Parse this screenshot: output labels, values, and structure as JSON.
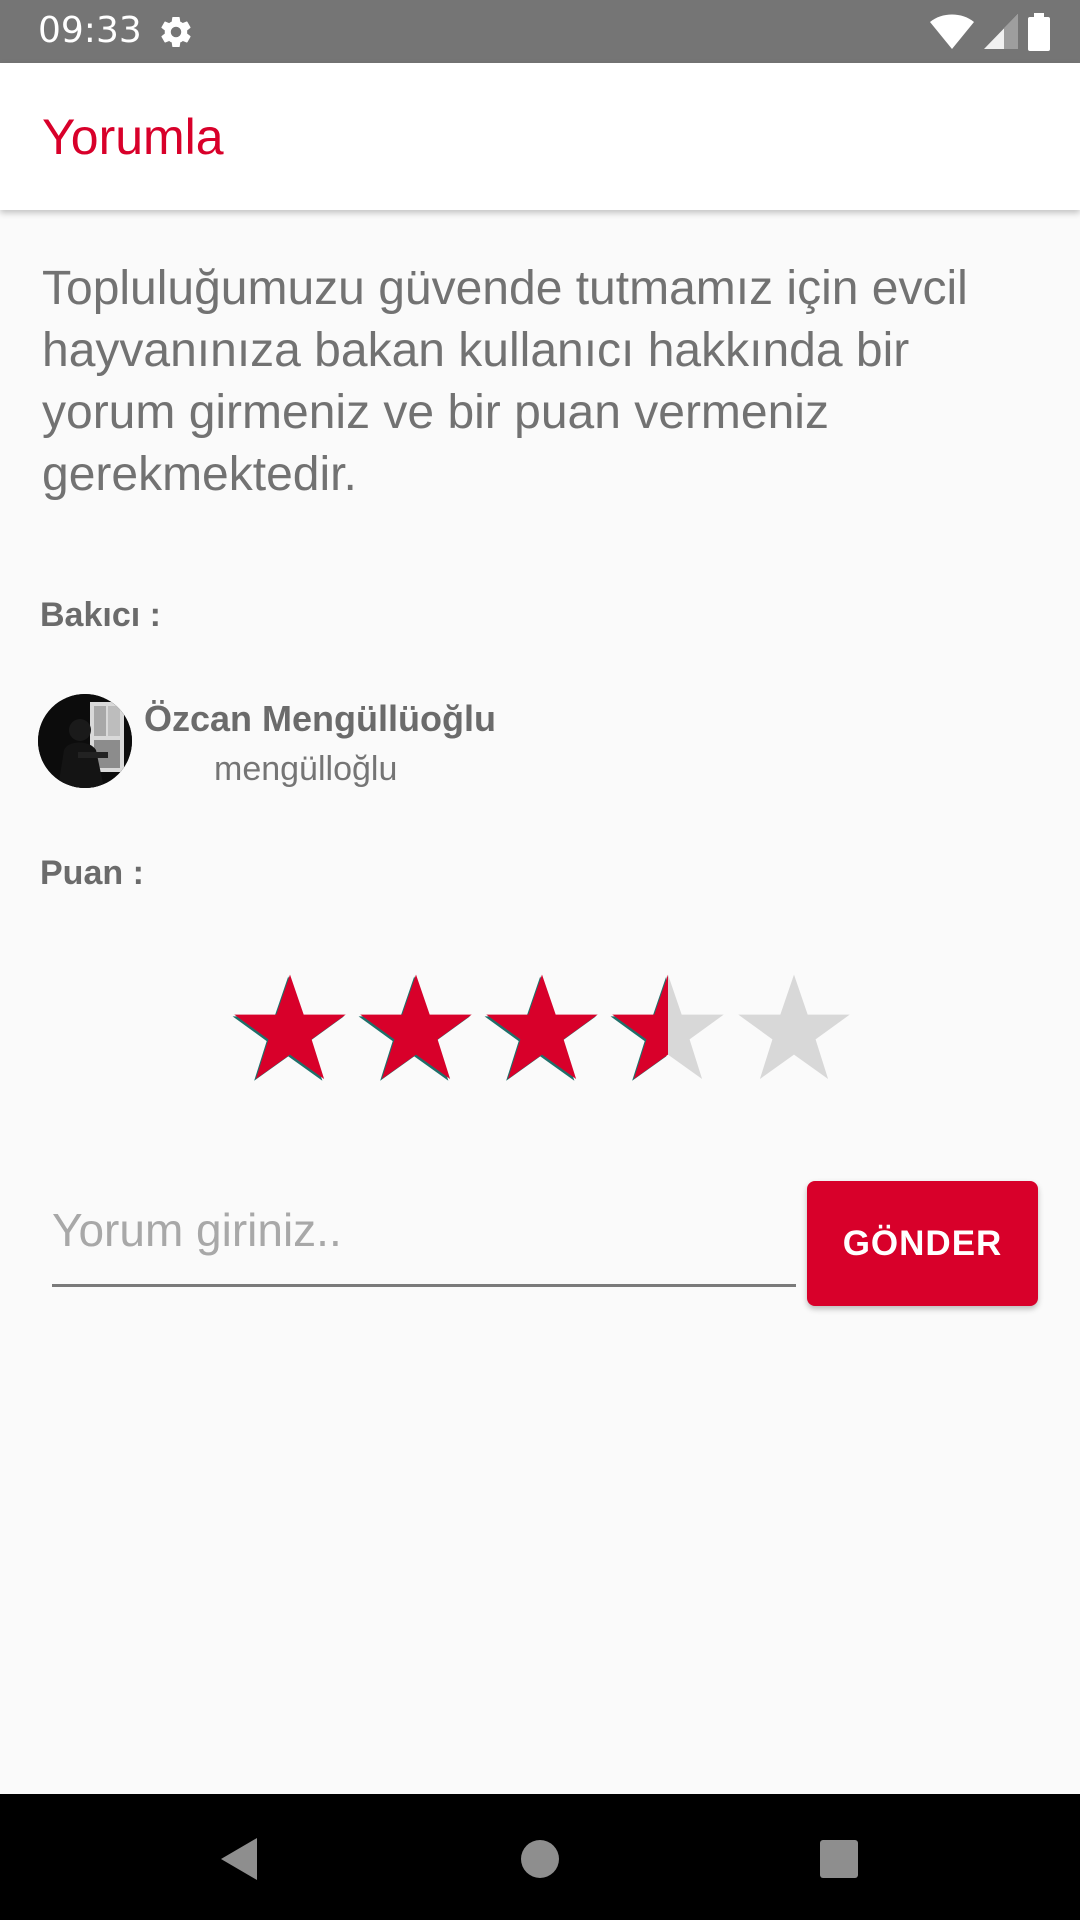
{
  "status_bar": {
    "time": "09:33",
    "icons": [
      "gear-icon",
      "wifi-icon",
      "signal-icon",
      "battery-icon"
    ]
  },
  "app_bar": {
    "title": "Yorumla"
  },
  "intro_text": "Topluluğumuzu güvende tutmamız için evcil hayvanınıza bakan kullanıcı hakkında bir yorum girmeniz ve bir puan vermeniz gerekmektedir.",
  "carer": {
    "label": "Bakıcı :",
    "name": "Özcan Mengüllüoğlu",
    "username": "mengülloğlu"
  },
  "rating": {
    "label": "Puan :",
    "value": 3.5,
    "max": 5
  },
  "comment": {
    "placeholder": "Yorum giriniz..",
    "value": "",
    "send_label": "GÖNDER"
  },
  "nav_bar": {
    "icons": [
      "back-icon",
      "home-icon",
      "recents-icon"
    ]
  },
  "colors": {
    "accent": "#d8002a",
    "star_empty": "#d8d8d8",
    "text_gray": "#727272"
  }
}
